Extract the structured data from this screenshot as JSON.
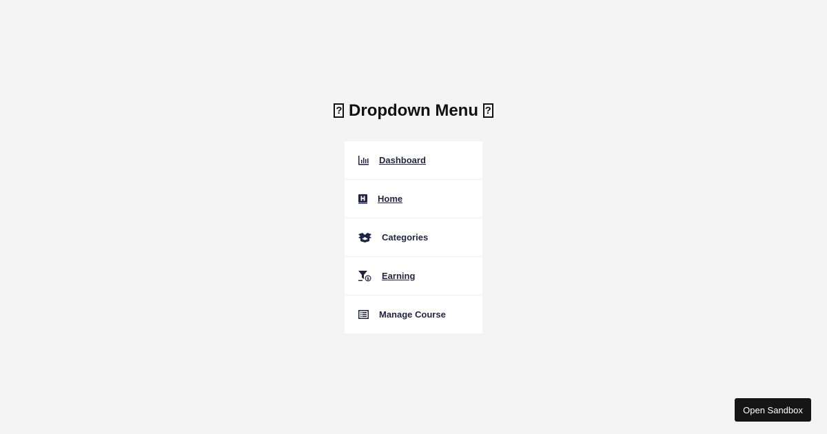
{
  "page": {
    "title": "Dropdown Menu",
    "title_glyph_left": "box-glyph",
    "title_glyph_right": "box-glyph"
  },
  "menu": {
    "items": [
      {
        "label": "Dashboard",
        "icon": "bar-chart-icon",
        "underlined": true
      },
      {
        "label": "Home",
        "icon": "h-square-icon",
        "underlined": true
      },
      {
        "label": "Categories",
        "icon": "open-box-icon",
        "underlined": false
      },
      {
        "label": "Earning",
        "icon": "filter-dollar-icon",
        "underlined": true
      },
      {
        "label": "Manage Course",
        "icon": "list-icon",
        "underlined": false
      }
    ]
  },
  "sandbox_button": {
    "label": "Open Sandbox"
  },
  "colors": {
    "background": "#f4f4f4",
    "menu_bg": "#ffffff",
    "text": "#1f2540",
    "button_bg": "#151515"
  }
}
